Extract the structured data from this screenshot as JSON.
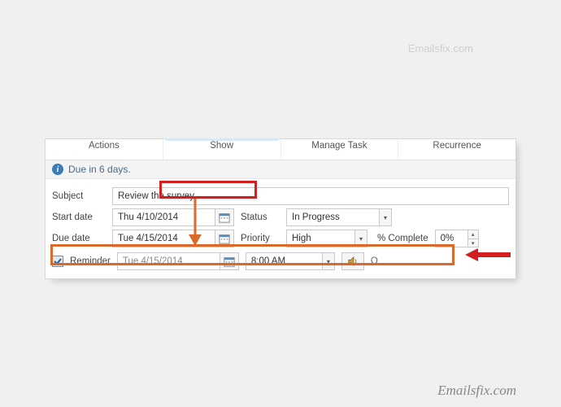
{
  "watermark": "Emailsfix.com",
  "ribbon": {
    "actions": "Actions",
    "show": "Show",
    "manage_task": "Manage Task",
    "recurrence": "Recurrence"
  },
  "info_bar": {
    "text": "Due in 6 days."
  },
  "labels": {
    "subject": "Subject",
    "start_date": "Start date",
    "due_date": "Due date",
    "status": "Status",
    "priority": "Priority",
    "pct_complete": "% Complete",
    "reminder": "Reminder",
    "owner_abbrev": "O"
  },
  "fields": {
    "subject": "Review the survey",
    "start_date": "Thu 4/10/2014",
    "due_date": "Tue 4/15/2014",
    "status": "In Progress",
    "priority": "High",
    "pct_complete": "0%",
    "reminder_date": "Tue 4/15/2014",
    "reminder_time": "8:00 AM"
  },
  "colors": {
    "red": "#d22020",
    "orange": "#d96a2b"
  }
}
